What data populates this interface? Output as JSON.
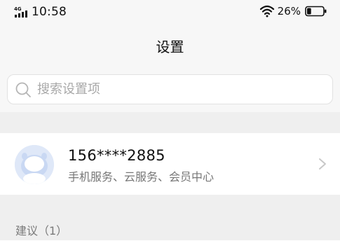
{
  "status_bar": {
    "network": "4G",
    "time": "10:58",
    "battery_percent": "26%",
    "battery_level": 0.26
  },
  "header": {
    "title": "设置"
  },
  "search": {
    "placeholder": "搜索设置项"
  },
  "account": {
    "phone": "156****2885",
    "services": "手机服务、云服务、会员中心"
  },
  "suggestions": {
    "header": "建议（1）"
  },
  "icons": {
    "signal": "signal-4g-icon",
    "wifi": "wifi-icon",
    "battery": "battery-icon",
    "search": "search-icon",
    "chevron": "chevron-right-icon",
    "avatar": "avatar"
  },
  "colors": {
    "background": "#f7f7f7",
    "card": "#ffffff",
    "avatar_bg": "#dfe8f8",
    "muted_text": "#777777"
  }
}
